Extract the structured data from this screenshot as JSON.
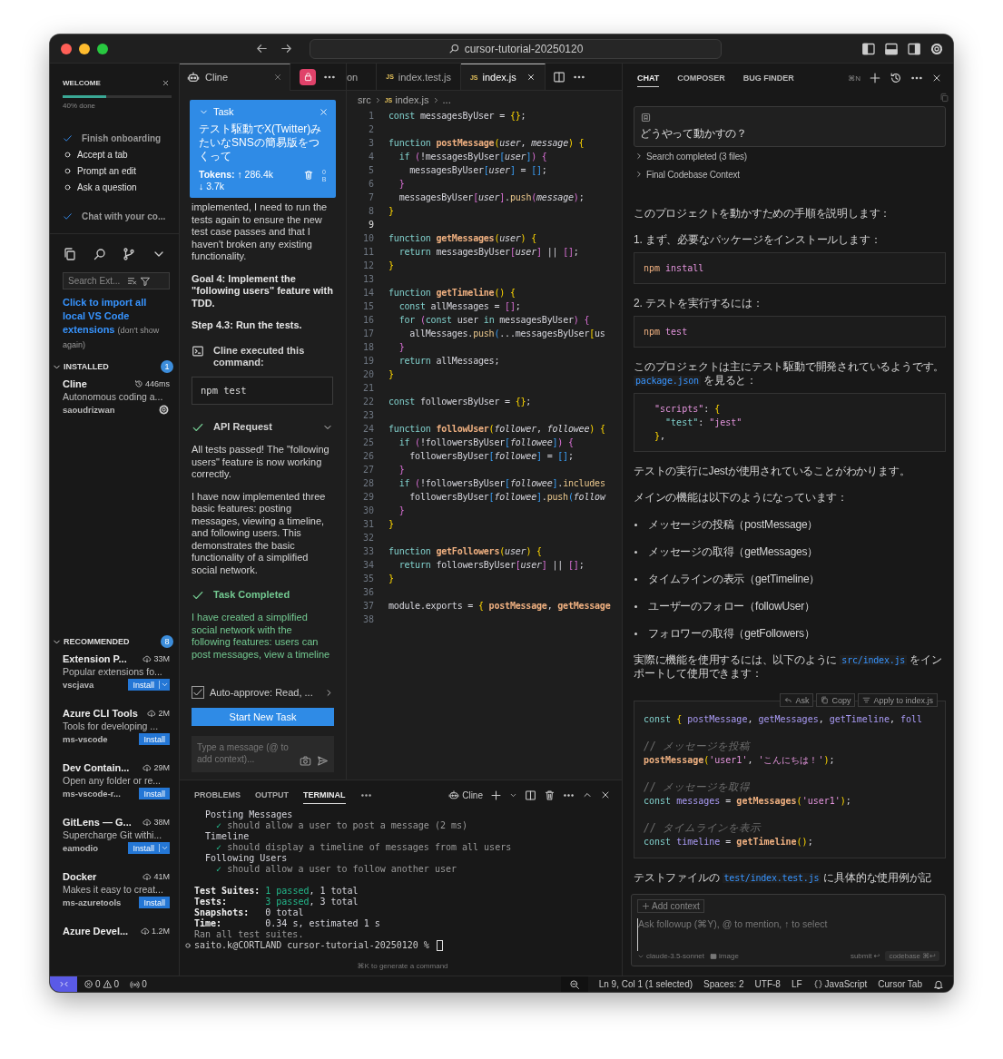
{
  "window": {
    "title": "cursor-tutorial-20250120"
  },
  "welcome": {
    "title": "WELCOME",
    "level": 0.4,
    "progress": "40% done",
    "steps": [
      {
        "label": "Finish onboarding",
        "done": true
      },
      {
        "label": "Accept a tab",
        "done": false
      },
      {
        "label": "Prompt an edit",
        "done": false
      },
      {
        "label": "Ask a question",
        "done": false
      },
      {
        "label": "Chat with your co...",
        "done": true
      }
    ]
  },
  "extensions": {
    "search": {
      "placeholder": "Search Ext..."
    },
    "import_link": "Click to import all local VS Code extensions",
    "import_note": "(don't show again)",
    "sections": [
      {
        "title": "INSTALLED",
        "count": "1",
        "expanded": true,
        "items": [
          {
            "kind": "installed",
            "name": "Cline",
            "stat": "446ms",
            "description": "Autonomous coding a...",
            "publisher": "saoudrizwan"
          }
        ]
      },
      {
        "title": "RECOMMENDED",
        "count": "8",
        "expanded": true,
        "items": [
          {
            "kind": "recommended",
            "name": "Extension P...",
            "stat": "33M",
            "description": "Popular extensions fo...",
            "publisher": "vscjava",
            "button": "Install",
            "split": true
          },
          {
            "kind": "recommended",
            "name": "Azure CLI Tools",
            "stat": "2M",
            "description": "Tools for developing ...",
            "publisher": "ms-vscode",
            "button": "Install",
            "split": false
          },
          {
            "kind": "recommended",
            "name": "Dev Contain...",
            "stat": "29M",
            "description": "Open any folder or re...",
            "publisher": "ms-vscode-r...",
            "button": "Install",
            "split": false
          },
          {
            "kind": "recommended",
            "name": "GitLens — G...",
            "stat": "38M",
            "description": "Supercharge Git withi...",
            "publisher": "eamodio",
            "button": "Install",
            "split": true
          },
          {
            "kind": "recommended",
            "name": "Docker",
            "stat": "41M",
            "description": "Makes it easy to creat...",
            "publisher": "ms-azuretools",
            "button": "Install",
            "split": false
          },
          {
            "kind": "recommended",
            "name": "Azure Devel...",
            "stat": "1.2M"
          }
        ]
      }
    ]
  },
  "cline": {
    "tab": "Cline",
    "task": {
      "title": "Task",
      "text": "テスト駆動でX(Twitter)みたいなSNSの簡易版をつくって",
      "tokens_label": "Tokens:",
      "tokens_in": "↑ 286.4k",
      "tokens_out": "↓ 3.7k",
      "size": "0 B"
    },
    "messages": [
      {
        "kind": "text",
        "text": "implemented, I need to run the tests again to ensure the new test case passes and that I haven't broken any existing functionality."
      },
      {
        "kind": "heading",
        "text": "Goal 4: Implement the \"following users\" feature with TDD."
      },
      {
        "kind": "heading",
        "text": "Step 4.3: Run the tests."
      },
      {
        "kind": "command",
        "title": "Cline executed this command:",
        "code": "npm test"
      },
      {
        "kind": "api",
        "title": "API Request",
        "expanded": false
      },
      {
        "kind": "text",
        "text": "All tests passed! The \"following users\" feature is now working correctly."
      },
      {
        "kind": "text",
        "text": "I have now implemented three basic features: posting messages, viewing a timeline, and following users. This demonstrates the basic functionality of a simplified social network."
      },
      {
        "kind": "completed",
        "title": "Task Completed"
      },
      {
        "kind": "result",
        "text": "I have created a simplified social network with the following features: users can post messages, view a timeline"
      }
    ],
    "auto_approve": {
      "label": "Auto-approve: Read, ...",
      "checked": true
    },
    "new_task": "Start New Task",
    "input": {
      "placeholder": "Type a message (@ to add context)..."
    }
  },
  "editor": {
    "tabs": [
      {
        "label": "on",
        "selected": false
      },
      {
        "label": "index.test.js",
        "file_icon": "JS",
        "selected": false
      },
      {
        "label": "index.js",
        "file_icon": "JS",
        "selected": true
      }
    ],
    "breadcrumb": [
      {
        "label": "src"
      },
      {
        "label": "index.js",
        "file_icon": "JS"
      },
      {
        "label": "..."
      }
    ],
    "lines": [
      {
        "number": "1",
        "active": false,
        "tokens": [
          {
            "kind": "k",
            "text": "const"
          },
          {
            "kind": "t",
            "text": " messagesByUser = "
          },
          {
            "kind": "y",
            "text": "{}"
          },
          {
            "kind": "t",
            "text": ";"
          }
        ]
      },
      {
        "number": "2",
        "active": false
      },
      {
        "number": "3",
        "active": false,
        "tokens": [
          {
            "kind": "k",
            "text": "function"
          },
          {
            "kind": "f",
            "text": " postMessage"
          },
          {
            "kind": "y",
            "text": "("
          },
          {
            "kind": "p",
            "text": "user"
          },
          {
            "kind": "t",
            "text": ", "
          },
          {
            "kind": "p",
            "text": "message"
          },
          {
            "kind": "y",
            "text": ")"
          },
          {
            "kind": "y",
            "text": " {"
          }
        ]
      },
      {
        "number": "4",
        "active": false,
        "tokens": [
          {
            "kind": "k",
            "text": "  if"
          },
          {
            "kind": "m",
            "text": " ("
          },
          {
            "kind": "t",
            "text": "!messagesByUser"
          },
          {
            "kind": "b",
            "text": "["
          },
          {
            "kind": "p",
            "text": "user"
          },
          {
            "kind": "b",
            "text": "]"
          },
          {
            "kind": "m",
            "text": ")"
          },
          {
            "kind": "m",
            "text": " {"
          }
        ]
      },
      {
        "number": "5",
        "active": false,
        "tokens": [
          {
            "kind": "t",
            "text": "    messagesByUser"
          },
          {
            "kind": "b",
            "text": "["
          },
          {
            "kind": "p",
            "text": "user"
          },
          {
            "kind": "b",
            "text": "]"
          },
          {
            "kind": "t",
            "text": " = "
          },
          {
            "kind": "b",
            "text": "[]"
          },
          {
            "kind": "t",
            "text": ";"
          }
        ]
      },
      {
        "number": "6",
        "active": false,
        "tokens": [
          {
            "kind": "m",
            "text": "  }"
          }
        ]
      },
      {
        "number": "7",
        "active": false,
        "tokens": [
          {
            "kind": "t",
            "text": "  messagesByUser"
          },
          {
            "kind": "m",
            "text": "["
          },
          {
            "kind": "p",
            "text": "user"
          },
          {
            "kind": "m",
            "text": "]"
          },
          {
            "kind": "t",
            "text": "."
          },
          {
            "kind": "x",
            "text": "push"
          },
          {
            "kind": "m",
            "text": "("
          },
          {
            "kind": "p",
            "text": "message"
          },
          {
            "kind": "m",
            "text": ")"
          },
          {
            "kind": "t",
            "text": ";"
          }
        ]
      },
      {
        "number": "8",
        "active": false,
        "tokens": [
          {
            "kind": "y",
            "text": "}"
          }
        ]
      },
      {
        "number": "9",
        "active": true
      },
      {
        "number": "10",
        "active": false,
        "tokens": [
          {
            "kind": "k",
            "text": "function"
          },
          {
            "kind": "f",
            "text": " getMessages"
          },
          {
            "kind": "y",
            "text": "("
          },
          {
            "kind": "p",
            "text": "user"
          },
          {
            "kind": "y",
            "text": ")"
          },
          {
            "kind": "y",
            "text": " {"
          }
        ]
      },
      {
        "number": "11",
        "active": false,
        "tokens": [
          {
            "kind": "k",
            "text": "  return"
          },
          {
            "kind": "t",
            "text": " messagesByUser"
          },
          {
            "kind": "m",
            "text": "["
          },
          {
            "kind": "p",
            "text": "user"
          },
          {
            "kind": "m",
            "text": "]"
          },
          {
            "kind": "t",
            "text": " || "
          },
          {
            "kind": "m",
            "text": "[]"
          },
          {
            "kind": "t",
            "text": ";"
          }
        ]
      },
      {
        "number": "12",
        "active": false,
        "tokens": [
          {
            "kind": "y",
            "text": "}"
          }
        ]
      },
      {
        "number": "13",
        "active": false
      },
      {
        "number": "14",
        "active": false,
        "tokens": [
          {
            "kind": "k",
            "text": "function"
          },
          {
            "kind": "f",
            "text": " getTimeline"
          },
          {
            "kind": "y",
            "text": "()"
          },
          {
            "kind": "y",
            "text": " {"
          }
        ]
      },
      {
        "number": "15",
        "active": false,
        "tokens": [
          {
            "kind": "k",
            "text": "  const"
          },
          {
            "kind": "t",
            "text": " allMessages = "
          },
          {
            "kind": "m",
            "text": "[]"
          },
          {
            "kind": "t",
            "text": ";"
          }
        ]
      },
      {
        "number": "16",
        "active": false,
        "tokens": [
          {
            "kind": "k",
            "text": "  for"
          },
          {
            "kind": "m",
            "text": " ("
          },
          {
            "kind": "k",
            "text": "const"
          },
          {
            "kind": "t",
            "text": " user "
          },
          {
            "kind": "k",
            "text": "in"
          },
          {
            "kind": "t",
            "text": " messagesByUser"
          },
          {
            "kind": "m",
            "text": ")"
          },
          {
            "kind": "m",
            "text": " {"
          }
        ]
      },
      {
        "number": "17",
        "active": false,
        "tokens": [
          {
            "kind": "t",
            "text": "    allMessages."
          },
          {
            "kind": "x",
            "text": "push"
          },
          {
            "kind": "b",
            "text": "("
          },
          {
            "kind": "t",
            "text": "...messagesByUser"
          },
          {
            "kind": "y",
            "text": "["
          },
          {
            "kind": "t",
            "text": "us"
          }
        ]
      },
      {
        "number": "18",
        "active": false,
        "tokens": [
          {
            "kind": "m",
            "text": "  }"
          }
        ]
      },
      {
        "number": "19",
        "active": false,
        "tokens": [
          {
            "kind": "k",
            "text": "  return"
          },
          {
            "kind": "t",
            "text": " allMessages;"
          }
        ]
      },
      {
        "number": "20",
        "active": false,
        "tokens": [
          {
            "kind": "y",
            "text": "}"
          }
        ]
      },
      {
        "number": "21",
        "active": false
      },
      {
        "number": "22",
        "active": false,
        "tokens": [
          {
            "kind": "k",
            "text": "const"
          },
          {
            "kind": "t",
            "text": " followersByUser = "
          },
          {
            "kind": "y",
            "text": "{}"
          },
          {
            "kind": "t",
            "text": ";"
          }
        ]
      },
      {
        "number": "23",
        "active": false
      },
      {
        "number": "24",
        "active": false,
        "tokens": [
          {
            "kind": "k",
            "text": "function"
          },
          {
            "kind": "f",
            "text": " followUser"
          },
          {
            "kind": "y",
            "text": "("
          },
          {
            "kind": "p",
            "text": "follower"
          },
          {
            "kind": "t",
            "text": ", "
          },
          {
            "kind": "p",
            "text": "followee"
          },
          {
            "kind": "y",
            "text": ")"
          },
          {
            "kind": "y",
            "text": " {"
          }
        ]
      },
      {
        "number": "25",
        "active": false,
        "tokens": [
          {
            "kind": "k",
            "text": "  if"
          },
          {
            "kind": "m",
            "text": " ("
          },
          {
            "kind": "t",
            "text": "!followersByUser"
          },
          {
            "kind": "b",
            "text": "["
          },
          {
            "kind": "p",
            "text": "followee"
          },
          {
            "kind": "b",
            "text": "]"
          },
          {
            "kind": "m",
            "text": ")"
          },
          {
            "kind": "m",
            "text": " {"
          }
        ]
      },
      {
        "number": "26",
        "active": false,
        "tokens": [
          {
            "kind": "t",
            "text": "    followersByUser"
          },
          {
            "kind": "b",
            "text": "["
          },
          {
            "kind": "p",
            "text": "followee"
          },
          {
            "kind": "b",
            "text": "]"
          },
          {
            "kind": "t",
            "text": " = "
          },
          {
            "kind": "b",
            "text": "[]"
          },
          {
            "kind": "t",
            "text": ";"
          }
        ]
      },
      {
        "number": "27",
        "active": false,
        "tokens": [
          {
            "kind": "m",
            "text": "  }"
          }
        ]
      },
      {
        "number": "28",
        "active": false,
        "tokens": [
          {
            "kind": "k",
            "text": "  if"
          },
          {
            "kind": "m",
            "text": " ("
          },
          {
            "kind": "t",
            "text": "!followersByUser"
          },
          {
            "kind": "b",
            "text": "["
          },
          {
            "kind": "p",
            "text": "followee"
          },
          {
            "kind": "b",
            "text": "]"
          },
          {
            "kind": "t",
            "text": "."
          },
          {
            "kind": "x",
            "text": "includes"
          }
        ]
      },
      {
        "number": "29",
        "active": false,
        "tokens": [
          {
            "kind": "t",
            "text": "    followersByUser"
          },
          {
            "kind": "b",
            "text": "["
          },
          {
            "kind": "p",
            "text": "followee"
          },
          {
            "kind": "b",
            "text": "]"
          },
          {
            "kind": "t",
            "text": "."
          },
          {
            "kind": "x",
            "text": "push"
          },
          {
            "kind": "b",
            "text": "("
          },
          {
            "kind": "p",
            "text": "follow"
          }
        ]
      },
      {
        "number": "30",
        "active": false,
        "tokens": [
          {
            "kind": "m",
            "text": "  }"
          }
        ]
      },
      {
        "number": "31",
        "active": false,
        "tokens": [
          {
            "kind": "y",
            "text": "}"
          }
        ]
      },
      {
        "number": "32",
        "active": false
      },
      {
        "number": "33",
        "active": false,
        "tokens": [
          {
            "kind": "k",
            "text": "function"
          },
          {
            "kind": "f",
            "text": " getFollowers"
          },
          {
            "kind": "y",
            "text": "("
          },
          {
            "kind": "p",
            "text": "user"
          },
          {
            "kind": "y",
            "text": ")"
          },
          {
            "kind": "y",
            "text": " {"
          }
        ]
      },
      {
        "number": "34",
        "active": false,
        "tokens": [
          {
            "kind": "k",
            "text": "  return"
          },
          {
            "kind": "t",
            "text": " followersByUser"
          },
          {
            "kind": "m",
            "text": "["
          },
          {
            "kind": "p",
            "text": "user"
          },
          {
            "kind": "m",
            "text": "]"
          },
          {
            "kind": "t",
            "text": " || "
          },
          {
            "kind": "m",
            "text": "[]"
          },
          {
            "kind": "t",
            "text": ";"
          }
        ]
      },
      {
        "number": "35",
        "active": false,
        "tokens": [
          {
            "kind": "y",
            "text": "}"
          }
        ]
      },
      {
        "number": "36",
        "active": false
      },
      {
        "number": "37",
        "active": false,
        "tokens": [
          {
            "kind": "t",
            "text": "module.exports = "
          },
          {
            "kind": "y",
            "text": "{"
          },
          {
            "kind": "f",
            "text": " postMessage"
          },
          {
            "kind": "t",
            "text": ", "
          },
          {
            "kind": "f",
            "text": "getMessage"
          }
        ]
      },
      {
        "number": "38",
        "active": false
      }
    ]
  },
  "chat": {
    "tabs": [
      {
        "label": "CHAT",
        "selected": true
      },
      {
        "label": "COMPOSER",
        "selected": false
      },
      {
        "label": "BUG FINDER",
        "selected": false
      }
    ],
    "shortcut": "⌘N",
    "question": "どうやって動かすの？",
    "steps": [
      {
        "label": "Search completed (3 files)",
        "expanded": false
      },
      {
        "label": "Final Codebase Context",
        "expanded": false
      }
    ],
    "blocks": [
      {
        "kind": "paragraph",
        "parts": [
          {
            "kind": "text",
            "text": "このプロジェクトを動かすための手順を説明します："
          }
        ]
      },
      {
        "kind": "paragraph",
        "parts": [
          {
            "kind": "text",
            "text": "1. まず、必要なパッケージをインストールします："
          }
        ]
      },
      {
        "kind": "code",
        "groups": [
          [
            [
              {
                "kind": "o",
                "text": "npm"
              },
              {
                "kind": "s",
                "text": " install"
              }
            ]
          ]
        ]
      },
      {
        "kind": "paragraph",
        "parts": [
          {
            "kind": "text",
            "text": "2. テストを実行するには："
          }
        ]
      },
      {
        "kind": "code",
        "groups": [
          [
            [
              {
                "kind": "o",
                "text": "npm"
              },
              {
                "kind": "s",
                "text": " test"
              }
            ]
          ]
        ]
      },
      {
        "kind": "paragraph",
        "parts": [
          {
            "kind": "text",
            "text": "このプロジェクトは主にテスト駆動で開発されているようです。"
          },
          {
            "kind": "code",
            "text": "package.json"
          },
          {
            "kind": "text",
            "text": " を見ると："
          }
        ]
      },
      {
        "kind": "code",
        "groups": [
          [
            [
              {
                "kind": "s",
                "text": "  \"scripts\""
              },
              {
                "kind": "t",
                "text": ": "
              },
              {
                "kind": "y",
                "text": "{"
              }
            ],
            [
              {
                "kind": "k",
                "text": "    \"test\""
              },
              {
                "kind": "t",
                "text": ": "
              },
              {
                "kind": "s",
                "text": "\"jest\""
              }
            ],
            [
              {
                "kind": "y",
                "text": "  }"
              },
              {
                "kind": "t",
                "text": ","
              }
            ]
          ]
        ]
      },
      {
        "kind": "paragraph",
        "parts": [
          {
            "kind": "text",
            "text": "テストの実行にJestが使用されていることがわかります。"
          }
        ]
      },
      {
        "kind": "paragraph",
        "parts": [
          {
            "kind": "text",
            "text": "メインの機能は以下のようになっています："
          }
        ]
      },
      {
        "kind": "bullet",
        "text": "メッセージの投稿（postMessage）"
      },
      {
        "kind": "bullet",
        "text": "メッセージの取得（getMessages）"
      },
      {
        "kind": "bullet",
        "text": "タイムラインの表示（getTimeline）"
      },
      {
        "kind": "bullet",
        "text": "ユーザーのフォロー（followUser）"
      },
      {
        "kind": "bullet",
        "text": "フォロワーの取得（getFollowers）"
      },
      {
        "kind": "paragraph",
        "parts": [
          {
            "kind": "text",
            "text": "実際に機能を使用するには、以下のように "
          },
          {
            "kind": "code",
            "text": "src/index.js"
          },
          {
            "kind": "text",
            "text": " をインポートして使用できます："
          }
        ]
      },
      {
        "kind": "code",
        "actions": [
          {
            "kind": "ask",
            "label": "Ask"
          },
          {
            "kind": "copy",
            "label": "Copy"
          },
          {
            "kind": "apply",
            "label": "Apply to index.js"
          }
        ],
        "groups": [
          [
            [
              {
                "kind": "k",
                "text": "const"
              },
              {
                "kind": "y",
                "text": " {"
              },
              {
                "kind": "v",
                "text": " postMessage"
              },
              {
                "kind": "t",
                "text": ", "
              },
              {
                "kind": "v",
                "text": "getMessages"
              },
              {
                "kind": "t",
                "text": ", "
              },
              {
                "kind": "v",
                "text": "getTimeline"
              },
              {
                "kind": "t",
                "text": ", "
              },
              {
                "kind": "v",
                "text": "foll"
              }
            ]
          ],
          [
            [
              {
                "kind": "c",
                "text": "// メッセージを投稿"
              }
            ],
            [
              {
                "kind": "f",
                "text": "postMessage"
              },
              {
                "kind": "y",
                "text": "("
              },
              {
                "kind": "s",
                "text": "'user1'"
              },
              {
                "kind": "t",
                "text": ", "
              },
              {
                "kind": "s",
                "text": "'こんにちは！'"
              },
              {
                "kind": "y",
                "text": ")"
              },
              {
                "kind": "t",
                "text": ";"
              }
            ]
          ],
          [
            [
              {
                "kind": "c",
                "text": "// メッセージを取得"
              }
            ],
            [
              {
                "kind": "k",
                "text": "const"
              },
              {
                "kind": "v",
                "text": " messages"
              },
              {
                "kind": "t",
                "text": " = "
              },
              {
                "kind": "f",
                "text": "getMessages"
              },
              {
                "kind": "y",
                "text": "("
              },
              {
                "kind": "s",
                "text": "'user1'"
              },
              {
                "kind": "y",
                "text": ")"
              },
              {
                "kind": "t",
                "text": ";"
              }
            ]
          ],
          [
            [
              {
                "kind": "c",
                "text": "// タイムラインを表示"
              }
            ],
            [
              {
                "kind": "k",
                "text": "const"
              },
              {
                "kind": "v",
                "text": " timeline"
              },
              {
                "kind": "t",
                "text": " = "
              },
              {
                "kind": "f",
                "text": "getTimeline"
              },
              {
                "kind": "y",
                "text": "()"
              },
              {
                "kind": "t",
                "text": ";"
              }
            ]
          ]
        ]
      },
      {
        "kind": "paragraph",
        "parts": [
          {
            "kind": "text",
            "text": "テストファイルの "
          },
          {
            "kind": "code",
            "text": "test/index.test.js"
          },
          {
            "kind": "text",
            "text": " に具体的な使用例が記"
          }
        ]
      }
    ],
    "input": {
      "add_context": "Add context",
      "placeholder": "Ask followup (⌘Y), @ to mention, ↑ to select",
      "model": "claude-3.5-sonnet",
      "image": "image",
      "submit": "submit ↩",
      "codebase": "codebase ⌘↩"
    }
  },
  "terminal": {
    "tabs": [
      {
        "label": "PROBLEMS",
        "selected": false
      },
      {
        "label": "OUTPUT",
        "selected": false
      },
      {
        "label": "TERMINAL",
        "selected": true
      }
    ],
    "shell": "Cline",
    "groups": [
      [
        [
          {
            "kind": "t",
            "text": "  Posting Messages"
          }
        ],
        [
          {
            "kind": "g",
            "text": "    ✓"
          },
          {
            "kind": "d",
            "text": " should allow a user to post a message (2 ms)"
          }
        ],
        [
          {
            "kind": "t",
            "text": "  Timeline"
          }
        ],
        [
          {
            "kind": "g",
            "text": "    ✓"
          },
          {
            "kind": "d",
            "text": " should display a timeline of messages from all users"
          }
        ],
        [
          {
            "kind": "t",
            "text": "  Following Users"
          }
        ],
        [
          {
            "kind": "g",
            "text": "    ✓"
          },
          {
            "kind": "d",
            "text": " should allow a user to follow another user"
          }
        ]
      ],
      [
        [
          {
            "kind": "w",
            "text": "Test Suites: "
          },
          {
            "kind": "g",
            "text": "1 passed"
          },
          {
            "kind": "t",
            "text": ", 1 total"
          }
        ],
        [
          {
            "kind": "w",
            "text": "Tests:       "
          },
          {
            "kind": "g",
            "text": "3 passed"
          },
          {
            "kind": "t",
            "text": ", 3 total"
          }
        ],
        [
          {
            "kind": "w",
            "text": "Snapshots:   "
          },
          {
            "kind": "t",
            "text": "0 total"
          }
        ],
        [
          {
            "kind": "w",
            "text": "Time:        "
          },
          {
            "kind": "t",
            "text": "0.34 s, estimated 1 s"
          }
        ],
        [
          {
            "kind": "d",
            "text": "Ran all test suites."
          }
        ]
      ]
    ],
    "prompt": "saito.k@CORTLAND cursor-tutorial-20250120 %",
    "hint": "⌘K to generate a command"
  },
  "status": {
    "errors": "0",
    "warnings": "0",
    "ports": "0",
    "position": "Ln 9, Col 1 (1 selected)",
    "indent": "Spaces: 2",
    "encoding": "UTF-8",
    "eol": "LF",
    "language": "JavaScript",
    "tab_mode": "Cursor Tab"
  }
}
